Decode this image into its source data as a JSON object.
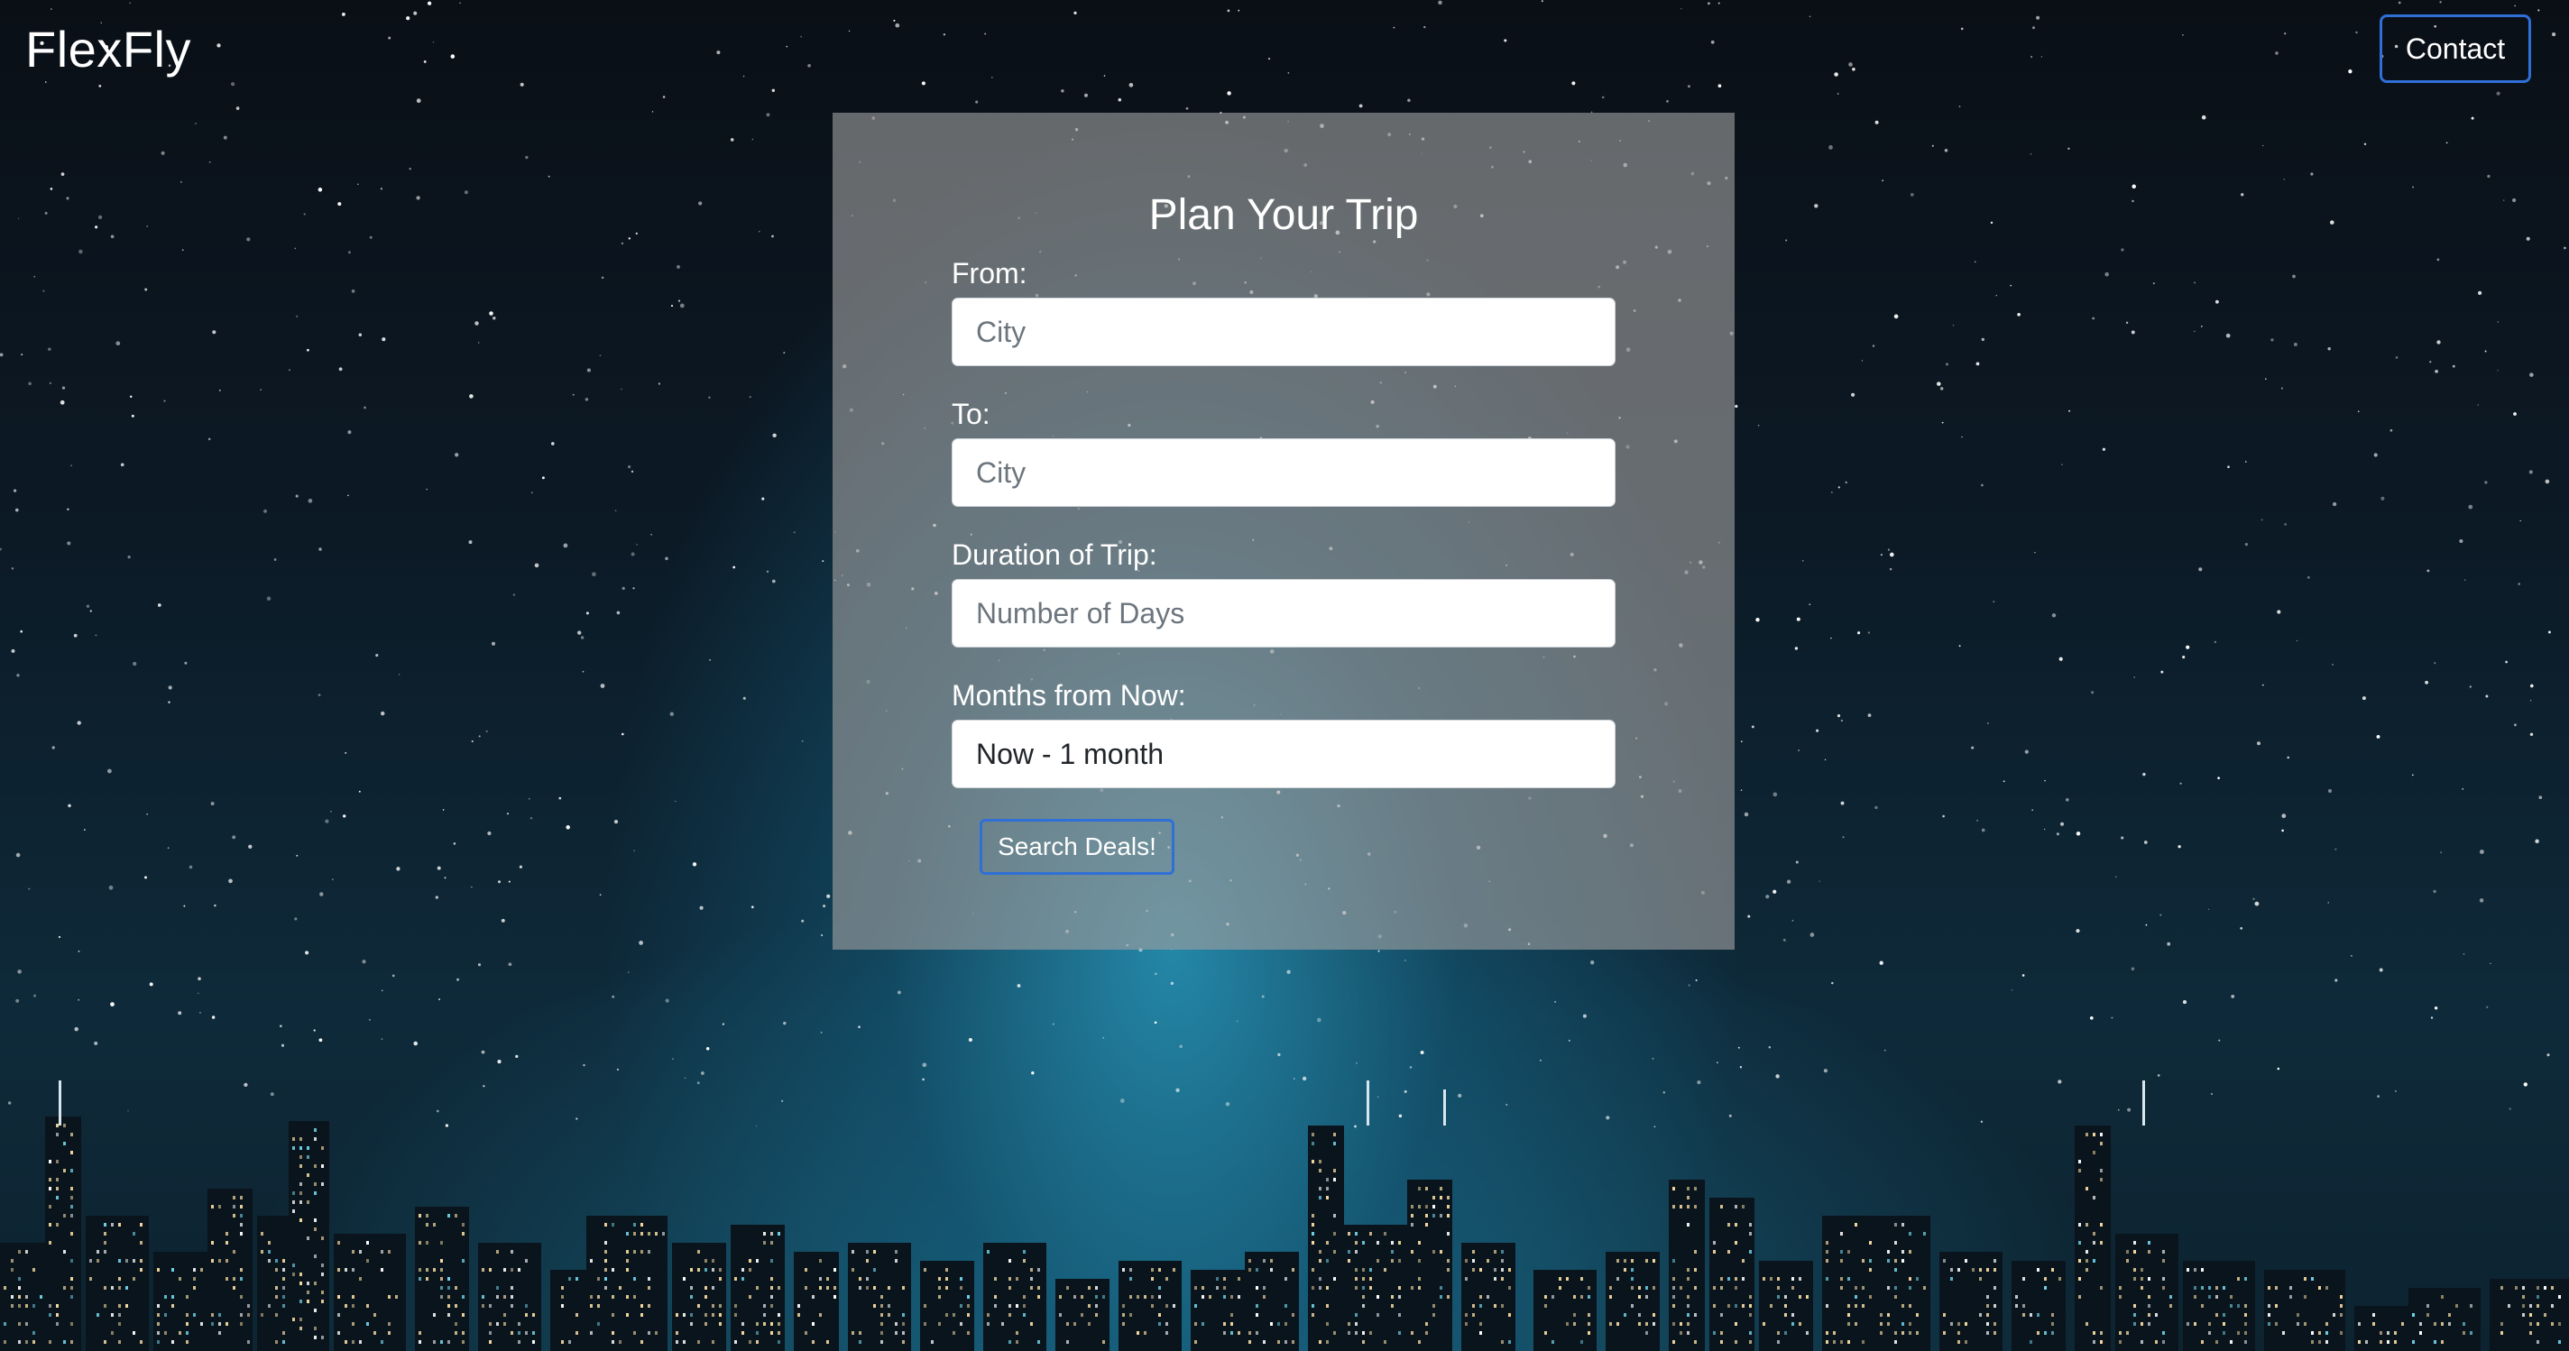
{
  "header": {
    "brand": "FlexFly",
    "contact_label": "Contact"
  },
  "form": {
    "title": "Plan Your Trip",
    "from": {
      "label": "From:",
      "placeholder": "City"
    },
    "to": {
      "label": "To:",
      "placeholder": "City"
    },
    "duration": {
      "label": "Duration of Trip:",
      "placeholder": "Number of Days"
    },
    "months": {
      "label": "Months from Now:",
      "selected": "Now - 1 month"
    },
    "submit_label": "Search Deals!"
  },
  "colors": {
    "accent_border": "#2f6fd6",
    "panel_bg": "rgba(160,160,160,0.62)"
  }
}
